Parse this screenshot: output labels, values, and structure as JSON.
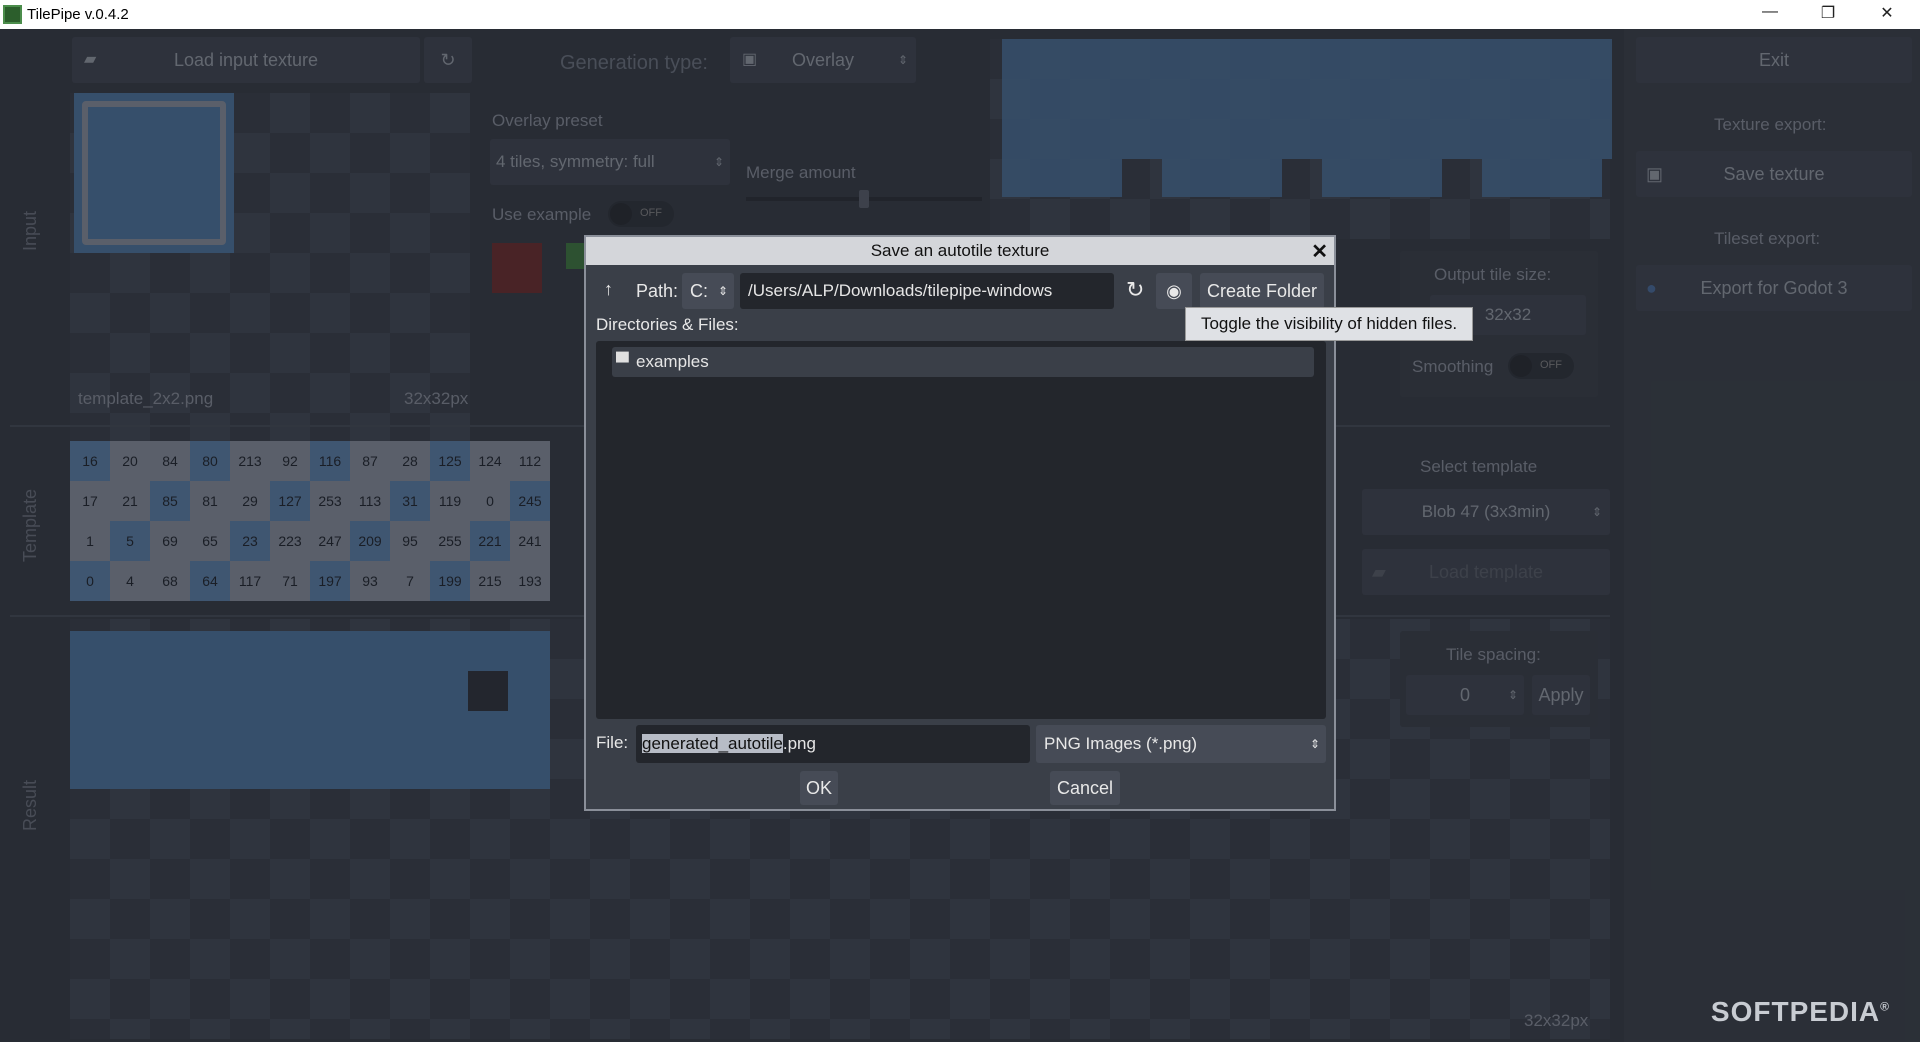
{
  "window": {
    "title": "TilePipe v.0.4.2",
    "controls": {
      "minimize": "—",
      "restore": "❐",
      "close": "✕"
    }
  },
  "input": {
    "load_button": "Load input texture",
    "refresh_icon": "↻",
    "side_label": "Input",
    "filename": "template_2x2.png",
    "size": "32x32px"
  },
  "generation": {
    "label": "Generation type:",
    "value": "Overlay"
  },
  "overlay": {
    "preset_label": "Overlay preset",
    "preset_value": "4 tiles, symmetry: full",
    "merge_label": "Merge amount",
    "merge_level": 0.5,
    "use_example_label": "Use example",
    "use_example_state": "OFF"
  },
  "template": {
    "side_label": "Template",
    "rows": [
      [
        "16",
        "20",
        "84",
        "80",
        "213",
        "92",
        "116",
        "87",
        "28",
        "125",
        "124",
        "112"
      ],
      [
        "17",
        "21",
        "85",
        "81",
        "29",
        "127",
        "253",
        "113",
        "31",
        "119",
        "0",
        "245"
      ],
      [
        "1",
        "5",
        "69",
        "65",
        "23",
        "223",
        "247",
        "209",
        "95",
        "255",
        "221",
        "241"
      ],
      [
        "0",
        "4",
        "68",
        "64",
        "117",
        "71",
        "197",
        "93",
        "7",
        "199",
        "215",
        "193"
      ]
    ]
  },
  "result": {
    "side_label": "Result",
    "size": "32x32px"
  },
  "right": {
    "exit": "Exit",
    "texture_export": "Texture export:",
    "save_texture": "Save texture",
    "tileset_export": "Tileset export:",
    "export_godot": "Export for Godot 3",
    "output_size_label": "Output tile size:",
    "output_size_value": "32x32",
    "smoothing_label": "Smoothing",
    "smoothing_state": "OFF",
    "select_template": "Select template",
    "template_value": "Blob 47 (3x3min)",
    "load_template": "Load template",
    "tile_spacing": "Tile spacing:",
    "spacing_value": "0",
    "apply": "Apply"
  },
  "dialog": {
    "title": "Save an autotile texture",
    "path_label": "Path:",
    "drive": "C:",
    "path": "/Users/ALP/Downloads/tilepipe-windows",
    "create_folder": "Create Folder",
    "dirs_label": "Directories & Files:",
    "entries": [
      "examples"
    ],
    "file_label": "File:",
    "file_name_selected": "generated_autotile",
    "file_name_rest": ".png",
    "filter": "PNG Images (*.png)",
    "ok": "OK",
    "cancel": "Cancel",
    "tooltip": "Toggle the visibility of hidden files."
  },
  "watermark": "SOFTPEDIA",
  "watermark_mark": "®",
  "colors": {
    "accent_blue": "#4f78a3",
    "background": "#363b44"
  }
}
